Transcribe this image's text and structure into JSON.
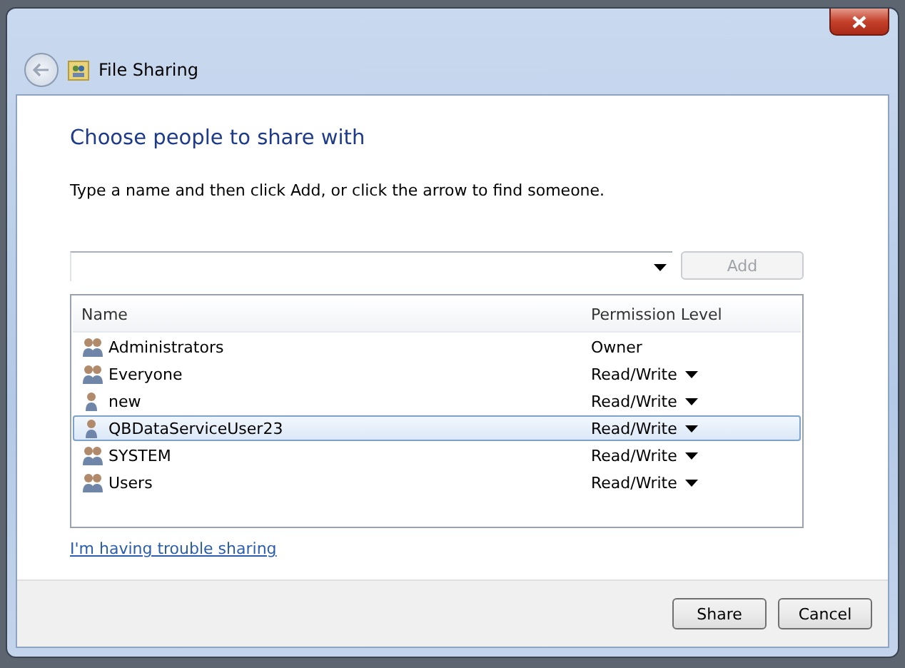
{
  "window": {
    "title": "File Sharing"
  },
  "heading": "Choose people to share with",
  "instruction": "Type a name and then click Add, or click the arrow to find someone.",
  "add_button": {
    "label": "Add",
    "disabled": true
  },
  "table": {
    "columns": [
      "Name",
      "Permission Level"
    ],
    "rows": [
      {
        "name": "Administrators",
        "kind": "group",
        "permission": "Owner",
        "has_menu": false,
        "selected": false
      },
      {
        "name": "Everyone",
        "kind": "group",
        "permission": "Read/Write",
        "has_menu": true,
        "selected": false
      },
      {
        "name": "new",
        "kind": "user",
        "permission": "Read/Write",
        "has_menu": true,
        "selected": false
      },
      {
        "name": "QBDataServiceUser23",
        "kind": "user",
        "permission": "Read/Write",
        "has_menu": true,
        "selected": true
      },
      {
        "name": "SYSTEM",
        "kind": "group",
        "permission": "Read/Write",
        "has_menu": true,
        "selected": false
      },
      {
        "name": "Users",
        "kind": "group",
        "permission": "Read/Write",
        "has_menu": true,
        "selected": false
      }
    ]
  },
  "help_link": "I'm having trouble sharing",
  "buttons": [
    "Share",
    "Cancel"
  ]
}
